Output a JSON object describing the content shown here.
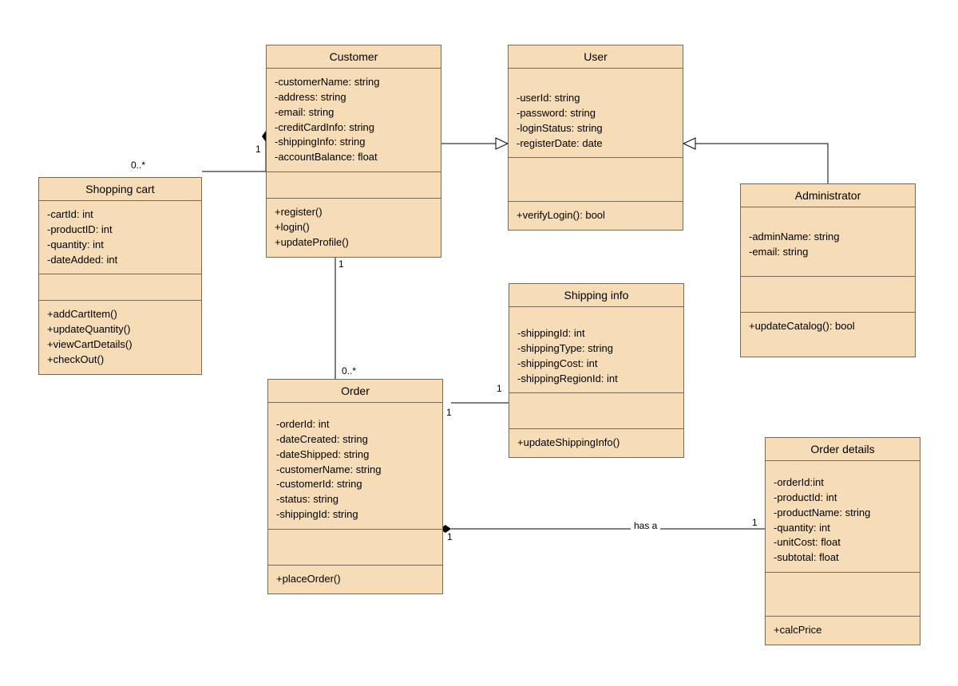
{
  "classes": {
    "shoppingCart": {
      "title": "Shopping cart",
      "attributes": [
        "-cartId: int",
        "-productID: int",
        "-quantity: int",
        "-dateAdded: int"
      ],
      "methods": [
        "+addCartItem()",
        "+updateQuantity()",
        "+viewCartDetails()",
        "+checkOut()"
      ]
    },
    "customer": {
      "title": "Customer",
      "attributes": [
        "-customerName: string",
        "-address: string",
        "-email: string",
        "-creditCardInfo: string",
        "-shippingInfo: string",
        "-accountBalance: float"
      ],
      "methods": [
        "+register()",
        "+login()",
        "+updateProfile()"
      ]
    },
    "user": {
      "title": "User",
      "attributes": [
        "-userId: string",
        "-password: string",
        "-loginStatus: string",
        "-registerDate: date"
      ],
      "methods": [
        "+verifyLogin(): bool"
      ]
    },
    "administrator": {
      "title": "Administrator",
      "attributes": [
        "-adminName: string",
        "-email: string"
      ],
      "methods": [
        "+updateCatalog(): bool"
      ]
    },
    "order": {
      "title": "Order",
      "attributes": [
        "-orderId: int",
        "-dateCreated: string",
        "-dateShipped: string",
        "-customerName: string",
        "-customerId: string",
        "-status: string",
        "-shippingId: string"
      ],
      "methods": [
        "+placeOrder()"
      ]
    },
    "shippingInfo": {
      "title": "Shipping info",
      "attributes": [
        "-shippingId: int",
        "-shippingType: string",
        "-shippingCost: int",
        "-shippingRegionId: int"
      ],
      "methods": [
        "+updateShippingInfo()"
      ]
    },
    "orderDetails": {
      "title": "Order details",
      "attributes": [
        "-orderId:int",
        "-productId: int",
        "-productName: string",
        "-quantity: int",
        "-unitCost: float",
        "-subtotal: float"
      ],
      "methods": [
        "+calcPrice"
      ]
    }
  },
  "relations": {
    "cartCustomer": {
      "mult1": "0..*",
      "mult2": "1"
    },
    "customerOrder": {
      "mult1": "1",
      "mult2": "0..*"
    },
    "orderShipping": {
      "mult1": "1",
      "mult2": "1"
    },
    "orderDetails": {
      "mult1": "1",
      "mult2": "1",
      "label": "has a"
    }
  }
}
